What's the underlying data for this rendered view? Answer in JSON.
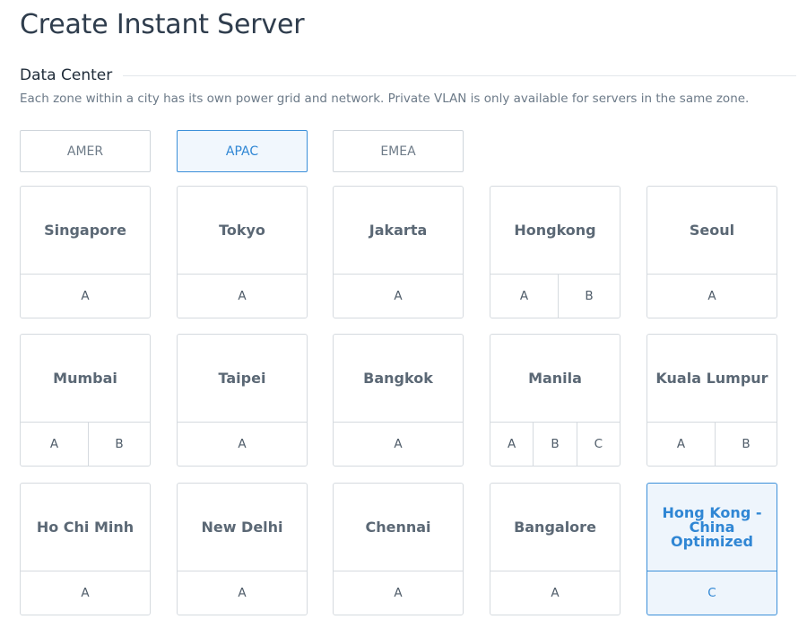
{
  "page": {
    "title": "Create Instant Server"
  },
  "data_center": {
    "title": "Data Center",
    "description": "Each zone within a city has its own power grid and network. Private VLAN is only available for servers in the same zone."
  },
  "regions": [
    {
      "label": "AMER",
      "active": false
    },
    {
      "label": "APAC",
      "active": true
    },
    {
      "label": "EMEA",
      "active": false
    }
  ],
  "locations": [
    {
      "name": "Singapore",
      "zones": [
        "A"
      ]
    },
    {
      "name": "Tokyo",
      "zones": [
        "A"
      ]
    },
    {
      "name": "Jakarta",
      "zones": [
        "A"
      ]
    },
    {
      "name": "Hongkong",
      "zones": [
        "A",
        "B"
      ]
    },
    {
      "name": "Seoul",
      "zones": [
        "A"
      ]
    },
    {
      "name": "Mumbai",
      "zones": [
        "A",
        "B"
      ]
    },
    {
      "name": "Taipei",
      "zones": [
        "A"
      ]
    },
    {
      "name": "Bangkok",
      "zones": [
        "A"
      ]
    },
    {
      "name": "Manila",
      "zones": [
        "A",
        "B",
        "C"
      ]
    },
    {
      "name": "Kuala Lumpur",
      "zones": [
        "A",
        "B"
      ]
    },
    {
      "name": "Ho Chi Minh",
      "zones": [
        "A"
      ]
    },
    {
      "name": "New Delhi",
      "zones": [
        "A"
      ]
    },
    {
      "name": "Chennai",
      "zones": [
        "A"
      ]
    },
    {
      "name": "Bangalore",
      "zones": [
        "A"
      ]
    },
    {
      "name": "Hong Kong - China Optimized",
      "zones": [
        "C"
      ],
      "selected": true
    }
  ],
  "colors": {
    "accent": "#3b8fd9",
    "accent_bg": "#eef5fc",
    "border": "#d5dadf",
    "text_muted": "#6c7a88"
  }
}
